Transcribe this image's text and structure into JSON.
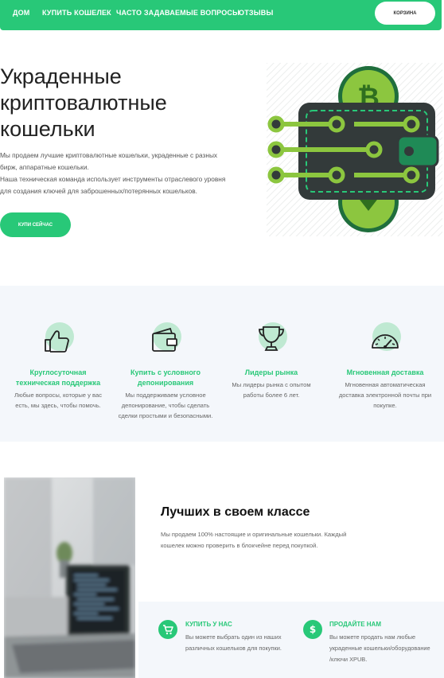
{
  "nav": {
    "items": [
      "ДОМ",
      "КУПИТЬ КОШЕЛЕК",
      "ЧАСТО ЗАДАВАЕМЫЕ ВОПРОСЫ",
      "ОТЗЫВЫ"
    ],
    "cart_label": "КОРЗИНА"
  },
  "hero": {
    "title_lines": [
      "Украденные",
      "криптовалютные",
      "кошельки"
    ],
    "text_lines": [
      "Мы продаем лучшие криптовалютные кошельки, украденные с разных",
      "бирж, аппаратные кошельки.",
      "Наша техническая команда использует инструменты отраслевого уровня",
      "для создания ключей для заброшенных/потерянных кошельков."
    ],
    "cta_label": "КУПИ СЕЙЧАС",
    "art_icon": "crypto-wallet-illustration"
  },
  "features": [
    {
      "icon": "thumbs-up-icon",
      "title_lines": [
        "Круглосуточная",
        "техническая поддержка"
      ],
      "desc_lines": [
        "Любые вопросы, которые у вас",
        "есть, мы здесь, чтобы помочь."
      ]
    },
    {
      "icon": "wallet-icon",
      "title_lines": [
        "Купить с условного",
        "депонирования"
      ],
      "desc_lines": [
        "Мы поддерживаем условное",
        "депонирование, чтобы сделать",
        "сделки простыми и безопасными."
      ]
    },
    {
      "icon": "trophy-icon",
      "title_lines": [
        "Лидеры рынка"
      ],
      "desc_lines": [
        "Мы лидеры рынка с опытом",
        "работы более 6 лет."
      ]
    },
    {
      "icon": "speedometer-icon",
      "title_lines": [
        "Мгновенная доставка"
      ],
      "desc_lines": [
        "Мгновенная автоматическая",
        "доставка электронной почты при",
        "покупке."
      ]
    }
  ],
  "best": {
    "title": "Лучших в своем классе",
    "text_lines": [
      "Мы продаем 100% настоящие и оригинальные кошельки. Каждый",
      "кошелек можно проверить в блокчейне перед покупкой."
    ]
  },
  "services": [
    {
      "icon": "cart-icon",
      "title": "КУПИТЬ У НАС",
      "text_lines": [
        "Вы можете выбрать один из наших",
        "различных кошельков для покупки."
      ]
    },
    {
      "icon": "dollar-icon",
      "title": "ПРОДАЙТЕ НАМ",
      "text_lines": [
        "Вы можете продать нам любые",
        "украденные кошельки/оборудование",
        "/ключи XPUB."
      ]
    }
  ],
  "colors": {
    "accent": "#28c878",
    "accent_light": "#bfe9d2",
    "band": "#f4f7fb",
    "wallet_dark": "#333a3a",
    "lime": "#8cc63f"
  }
}
